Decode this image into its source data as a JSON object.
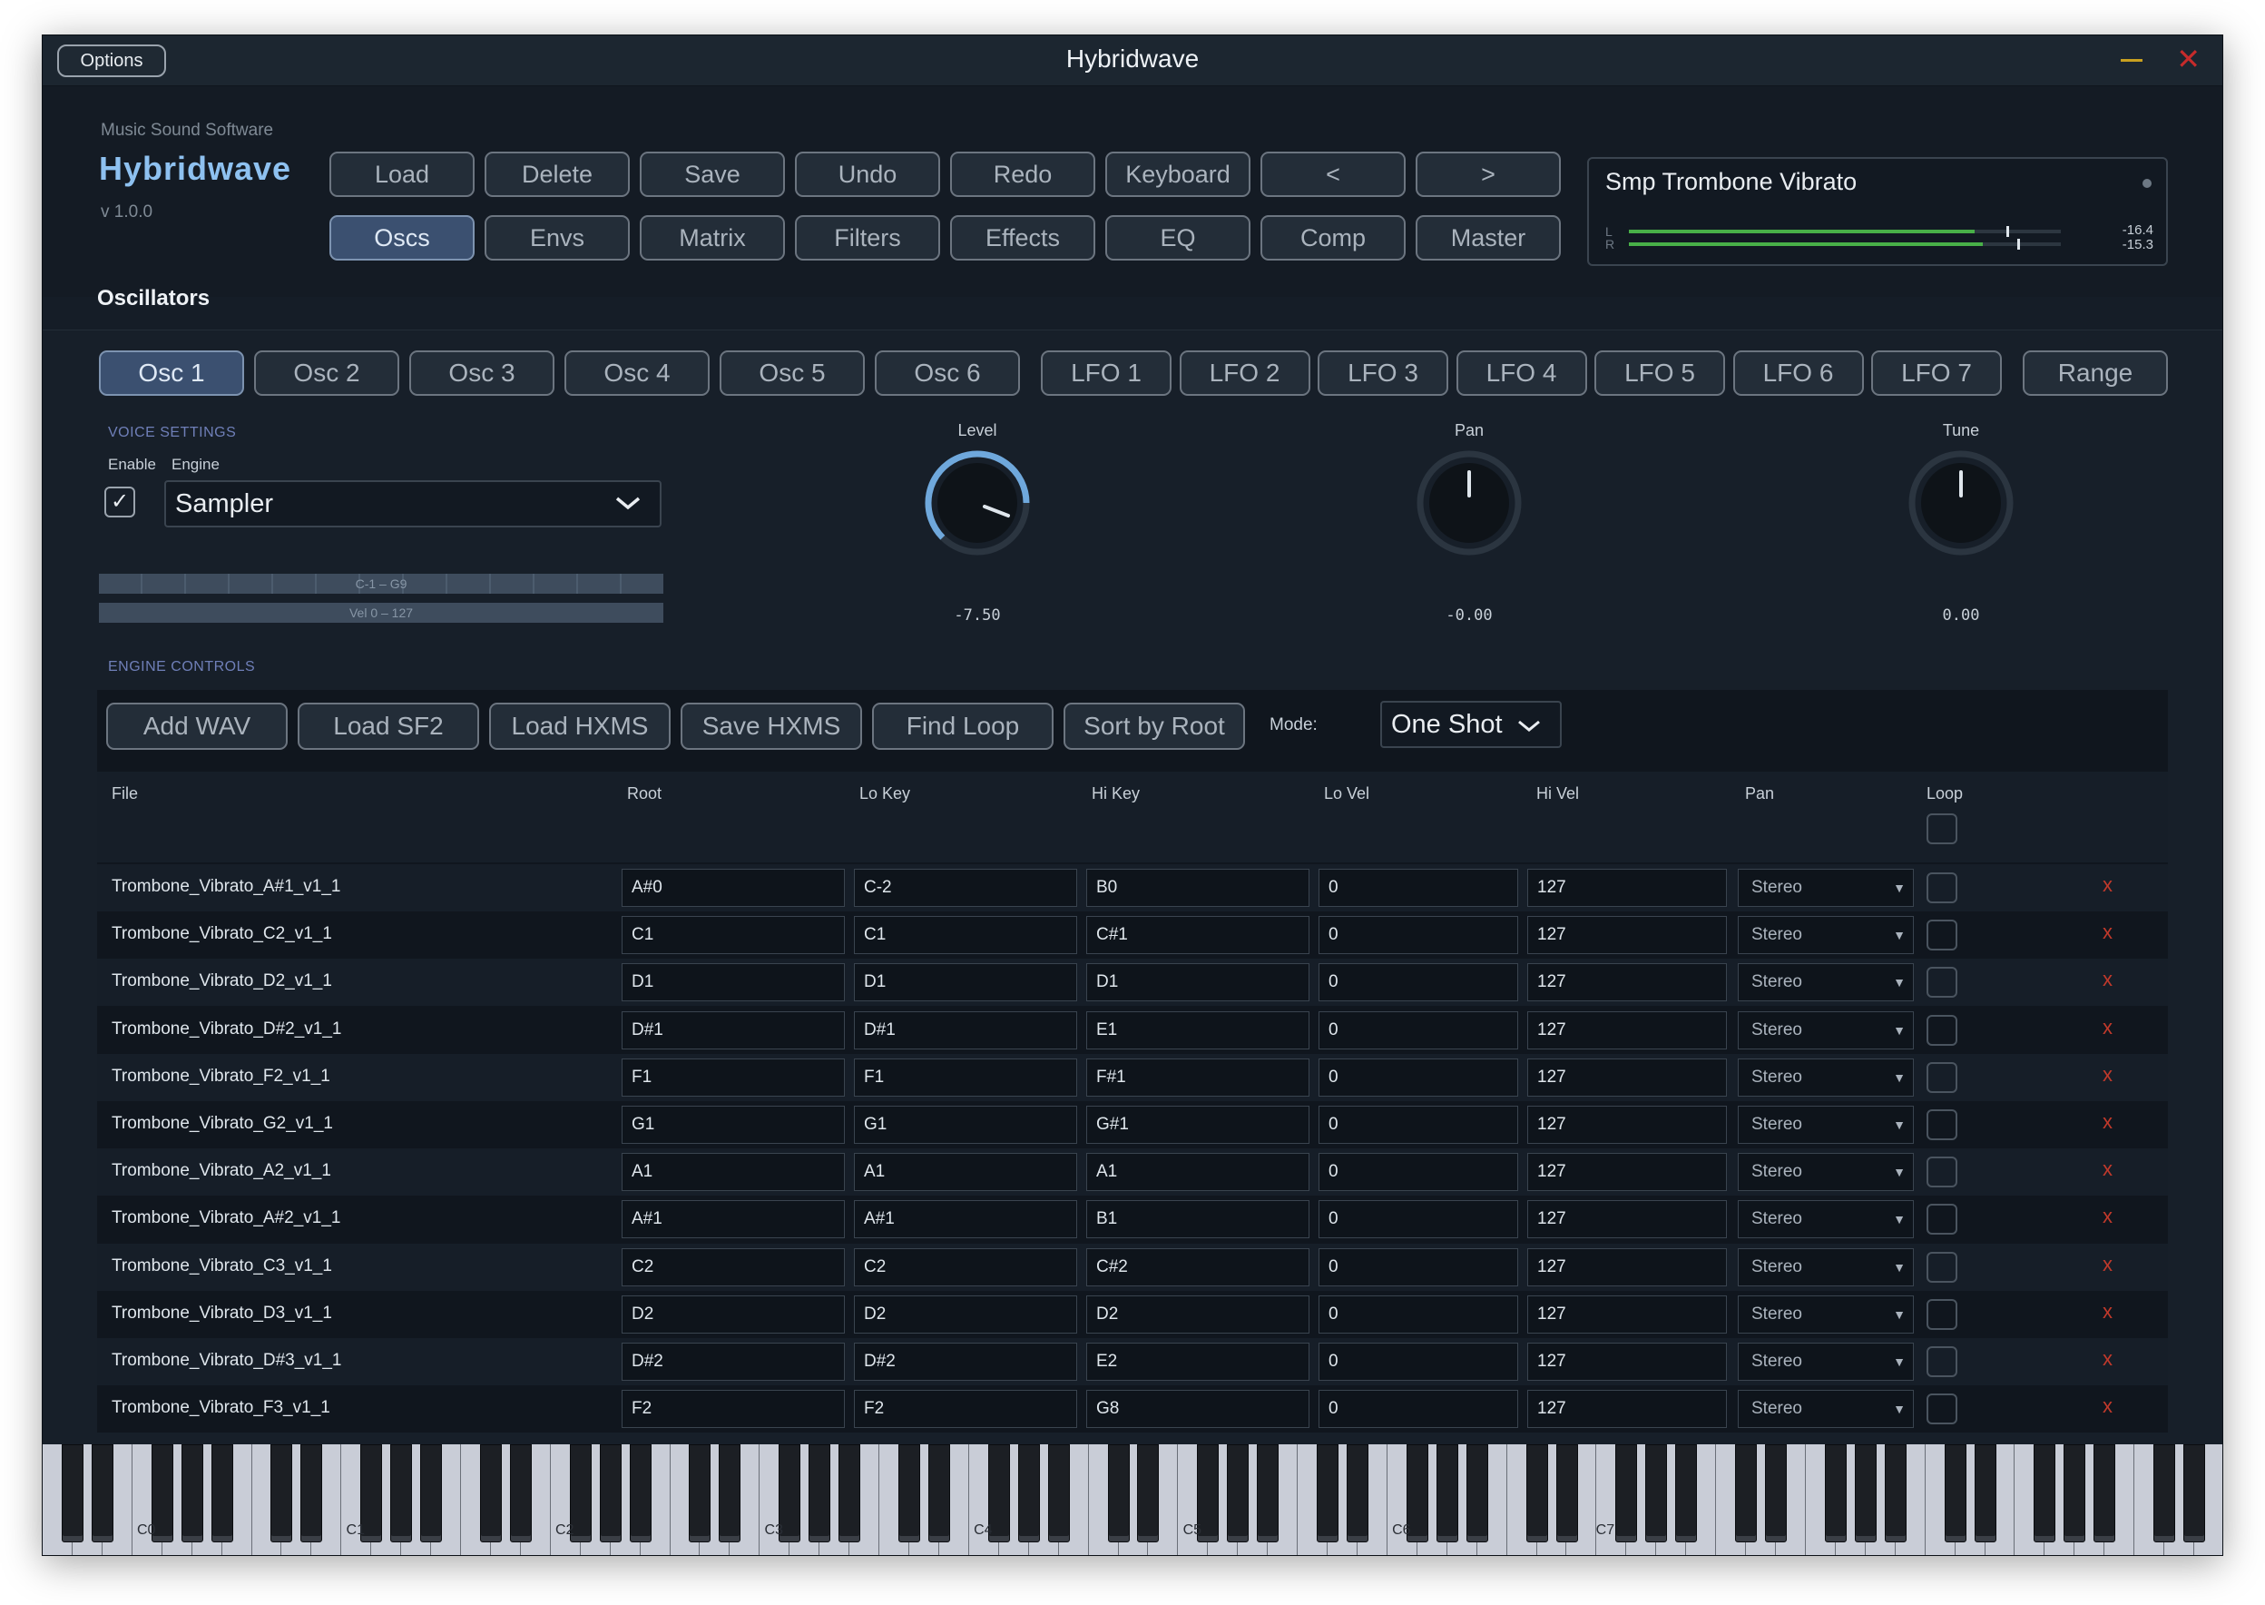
{
  "window": {
    "title": "Hybridwave",
    "options_label": "Options",
    "close_glyph": "✕"
  },
  "brand": {
    "company": "Music Sound Software",
    "name": "Hybridwave",
    "version": "v 1.0.0"
  },
  "toolbar": {
    "row1": [
      "Load",
      "Delete",
      "Save",
      "Undo",
      "Redo",
      "Keyboard",
      "<",
      ">"
    ],
    "row2": [
      "Oscs",
      "Envs",
      "Matrix",
      "Filters",
      "Effects",
      "EQ",
      "Comp",
      "Master"
    ],
    "active": "Oscs"
  },
  "preset": {
    "name": "Smp Trombone Vibrato",
    "meter_l_label": "L",
    "meter_r_label": "R",
    "meter_l_value": "-16.4",
    "meter_r_value": "-15.3",
    "meter_l_level": 0.8,
    "meter_r_level": 0.82
  },
  "section_title": "Oscillators",
  "osc_tabs": [
    "Osc 1",
    "Osc 2",
    "Osc 3",
    "Osc 4",
    "Osc 5",
    "Osc 6"
  ],
  "lfo_tabs": [
    "LFO 1",
    "LFO 2",
    "LFO 3",
    "LFO 4",
    "LFO 5",
    "LFO 6",
    "LFO 7"
  ],
  "range_tab": "Range",
  "active_tab": "Osc 1",
  "voice": {
    "header": "VOICE SETTINGS",
    "enable_label": "Enable",
    "engine_label": "Engine",
    "enabled_glyph": "✓",
    "engine_value": "Sampler",
    "key_range": "C-1 – G9",
    "vel_range": "Vel 0 – 127"
  },
  "knobs": {
    "level": {
      "label": "Level",
      "value": "-7.50"
    },
    "pan": {
      "label": "Pan",
      "value": "-0.00"
    },
    "tune": {
      "label": "Tune",
      "value": "0.00"
    }
  },
  "engine": {
    "header": "ENGINE CONTROLS",
    "buttons": [
      "Add WAV",
      "Load SF2",
      "Load HXMS",
      "Save HXMS",
      "Find Loop",
      "Sort by Root"
    ],
    "mode_label": "Mode:",
    "mode_value": "One Shot"
  },
  "table": {
    "columns": [
      "File",
      "Root",
      "Lo Key",
      "Hi Key",
      "Lo Vel",
      "Hi Vel",
      "Pan",
      "Loop"
    ],
    "delete_glyph": "x",
    "rows": [
      [
        "Trombone_Vibrato_A#1_v1_1",
        "A#0",
        "C-2",
        "B0",
        "0",
        "127",
        "Stereo"
      ],
      [
        "Trombone_Vibrato_C2_v1_1",
        "C1",
        "C1",
        "C#1",
        "0",
        "127",
        "Stereo"
      ],
      [
        "Trombone_Vibrato_D2_v1_1",
        "D1",
        "D1",
        "D1",
        "0",
        "127",
        "Stereo"
      ],
      [
        "Trombone_Vibrato_D#2_v1_1",
        "D#1",
        "D#1",
        "E1",
        "0",
        "127",
        "Stereo"
      ],
      [
        "Trombone_Vibrato_F2_v1_1",
        "F1",
        "F1",
        "F#1",
        "0",
        "127",
        "Stereo"
      ],
      [
        "Trombone_Vibrato_G2_v1_1",
        "G1",
        "G1",
        "G#1",
        "0",
        "127",
        "Stereo"
      ],
      [
        "Trombone_Vibrato_A2_v1_1",
        "A1",
        "A1",
        "A1",
        "0",
        "127",
        "Stereo"
      ],
      [
        "Trombone_Vibrato_A#2_v1_1",
        "A#1",
        "A#1",
        "B1",
        "0",
        "127",
        "Stereo"
      ],
      [
        "Trombone_Vibrato_C3_v1_1",
        "C2",
        "C2",
        "C#2",
        "0",
        "127",
        "Stereo"
      ],
      [
        "Trombone_Vibrato_D3_v1_1",
        "D2",
        "D2",
        "D2",
        "0",
        "127",
        "Stereo"
      ],
      [
        "Trombone_Vibrato_D#3_v1_1",
        "D#2",
        "D#2",
        "E2",
        "0",
        "127",
        "Stereo"
      ],
      [
        "Trombone_Vibrato_F3_v1_1",
        "F2",
        "F2",
        "G8",
        "0",
        "127",
        "Stereo"
      ]
    ]
  },
  "keyboard": {
    "octave_labels": [
      "C0",
      "C1",
      "C2",
      "C3",
      "C4",
      "C5",
      "C6",
      "C7"
    ]
  },
  "colors": {
    "accent": "#8ec1f0",
    "meter_green": "#48b048",
    "knob_ring": "#6fa8dc",
    "delete_red": "#c0392b"
  },
  "icons": {
    "dropdown": "chevron-down-icon",
    "close": "close-icon",
    "minimize": "minimize-icon",
    "check": "check-icon"
  }
}
